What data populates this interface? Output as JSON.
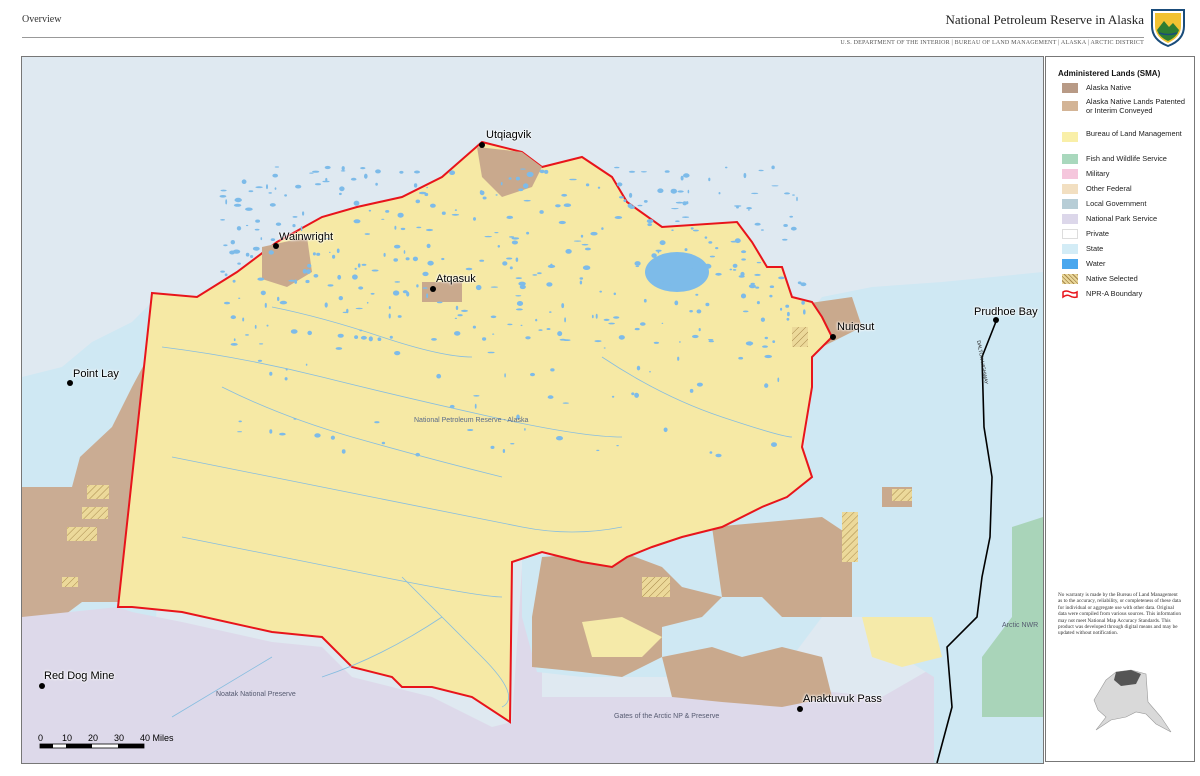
{
  "header": {
    "overview": "Overview",
    "title": "National Petroleum Reserve in Alaska",
    "subtitle": "U.S. DEPARTMENT OF THE INTERIOR | BUREAU OF LAND MANAGEMENT | ALASKA | ARCTIC DISTRICT",
    "logo_icon": "blm-logo-icon"
  },
  "map": {
    "towns": [
      {
        "name": "Utqiagvik"
      },
      {
        "name": "Wainwright"
      },
      {
        "name": "Atqasuk"
      },
      {
        "name": "Nuiqsut"
      },
      {
        "name": "Prudhoe Bay"
      },
      {
        "name": "Point Lay"
      },
      {
        "name": "Red Dog Mine"
      },
      {
        "name": "Anaktuvuk Pass"
      }
    ],
    "area_labels": {
      "npra": "National Petroleum Reserve - Alaska",
      "noatak": "Noatak National Preserve",
      "gates": "Gates of the Arctic NP & Preserve",
      "anwr": "Arctic NWR",
      "dalton": "DALTON HIGHWAY"
    },
    "scale_bar": {
      "ticks": [
        "0",
        "10",
        "20",
        "30",
        "40 Miles"
      ]
    },
    "colors": {
      "blm": "#f6e9a5",
      "native": "#c9a98d",
      "native_patented": "#d3b496",
      "fws": "#a9d4b9",
      "military": "#f3c3d9",
      "other_federal": "#f2e3c8",
      "local_gov": "#b7cdd6",
      "nps": "#ddd9ea",
      "private": "#ffffff",
      "state": "#cfe8f3",
      "water": "#7dbbe9",
      "ocean": "#dfe9f1",
      "boundary": "#e8141b"
    }
  },
  "legend": {
    "title": "Administered Lands (SMA)",
    "items": [
      {
        "label": "Alaska Native",
        "color": "#b89a86"
      },
      {
        "label": "Alaska Native Lands Patented or Interim Conveyed",
        "color": "#d3b496"
      },
      {
        "label": "Bureau of Land Management",
        "color": "#f9efa8"
      },
      {
        "label": "Fish and Wildlife Service",
        "color": "#a9d8bd"
      },
      {
        "label": "Military",
        "color": "#f5c6dc"
      },
      {
        "label": "Other Federal",
        "color": "#f2dfc1"
      },
      {
        "label": "Local Government",
        "color": "#b7cdd6"
      },
      {
        "label": "National Park Service",
        "color": "#dcd7ea"
      },
      {
        "label": "Private",
        "color": "#ffffff"
      },
      {
        "label": "State",
        "color": "#d3ecf6"
      },
      {
        "label": "Water",
        "color": "#4aa7ee"
      },
      {
        "label": "Native Selected",
        "color": "#e9d79a"
      },
      {
        "label": "NPR-A Boundary",
        "color": "#e8141b"
      }
    ],
    "disclaimer": "No warranty is made by the Bureau of Land Management as to the accuracy, reliability, or completeness of these data for individual or aggregate use with other data. Original data were compiled from various sources. This information may not meet National Map Accuracy Standards. This product was developed through digital means and may be updated without notification.",
    "inset_icon": "alaska-locator-icon"
  }
}
